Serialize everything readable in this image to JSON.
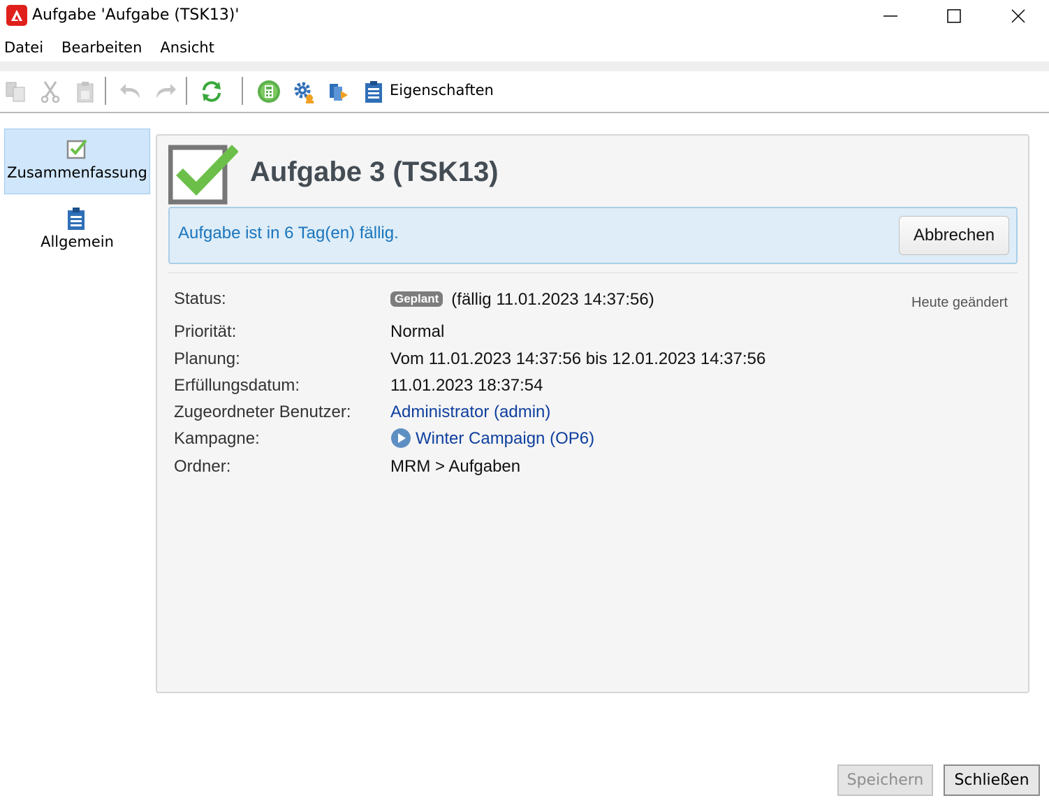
{
  "window": {
    "title": "Aufgabe 'Aufgabe (TSK13)'",
    "minimize_icon": "minimize-icon",
    "maximize_icon": "maximize-icon",
    "close_icon": "close-icon"
  },
  "menu": {
    "items": [
      "Datei",
      "Bearbeiten",
      "Ansicht"
    ]
  },
  "toolbar": {
    "icons": [
      "copy-icon",
      "cut-icon",
      "paste-icon",
      "undo-icon",
      "redo-icon",
      "refresh-icon",
      "calculator-icon",
      "gear-icon",
      "documents-icon",
      "clipboard-icon"
    ],
    "properties_label": "Eigenschaften"
  },
  "sidebar": {
    "items": [
      {
        "label": "Zusammenfassung",
        "icon": "checkbox-icon",
        "active": true
      },
      {
        "label": "Allgemein",
        "icon": "clipboard-icon",
        "active": false
      }
    ]
  },
  "summary": {
    "title": "Aufgabe 3 (TSK13)",
    "due_notice": "Aufgabe ist in 6 Tag(en) fällig.",
    "abort_label": "Abbrechen",
    "modified": "Heute geändert",
    "fields": {
      "status_label": "Status:",
      "status_badge": "Geplant",
      "status_due": "(fällig 11.01.2023 14:37:56)",
      "priority_label": "Priorität:",
      "priority_value": "Normal",
      "planning_label": "Planung:",
      "planning_value": "Vom 11.01.2023 14:37:56 bis 12.01.2023 14:37:56",
      "completion_label": "Erfüllungsdatum:",
      "completion_value": "11.01.2023 18:37:54",
      "user_label": "Zugeordneter Benutzer:",
      "user_value": "Administrator (admin)",
      "campaign_label": "Kampagne:",
      "campaign_value": "Winter Campaign (OP6)",
      "folder_label": "Ordner:",
      "folder_value": "MRM > Aufgaben"
    }
  },
  "footer": {
    "save_label": "Speichern",
    "close_label": "Schließen"
  },
  "colors": {
    "accent": "#1a75bd",
    "link": "#0f3f9e",
    "check_green": "#6cc04a",
    "selected_bg": "#cfe6fb"
  }
}
